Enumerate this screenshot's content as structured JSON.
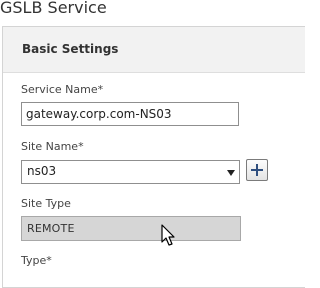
{
  "page": {
    "title": "GSLB Service"
  },
  "section": {
    "title": "Basic Settings",
    "service_name": {
      "label": "Service Name*",
      "value": "gateway.corp.com-NS03"
    },
    "site_name": {
      "label": "Site Name*",
      "selected": "ns03",
      "add_icon": "plus-icon"
    },
    "site_type": {
      "label": "Site Type",
      "value": "REMOTE"
    },
    "type": {
      "label": "Type*"
    }
  }
}
